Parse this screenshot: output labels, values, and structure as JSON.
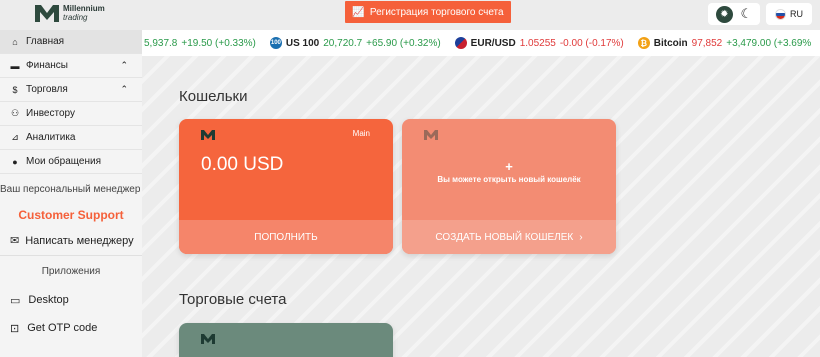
{
  "header": {
    "logo_top": "Millennium",
    "logo_bottom": "trading",
    "register_label": "Регистрация торгового счета",
    "lang": "RU"
  },
  "ticker": [
    {
      "symbol": "",
      "price": "5,937.8",
      "change": "+19.50 (+0.33%)",
      "negative": false,
      "icon": ""
    },
    {
      "symbol": "US 100",
      "price": "20,720.7",
      "change": "+65.90 (+0.32%)",
      "negative": false,
      "icon": "100"
    },
    {
      "symbol": "EUR/USD",
      "price": "1.05255",
      "change": "-0.00 (-0.17%)",
      "negative": true,
      "icon": "eu-us-flag-icon"
    },
    {
      "symbol": "Bitcoin",
      "price": "97,852",
      "change": "+3,479.00 (+3.69%",
      "negative": false,
      "icon": "bitcoin-icon"
    }
  ],
  "sidebar": {
    "items": [
      {
        "label": "Главная",
        "icon": "home-icon"
      },
      {
        "label": "Финансы",
        "icon": "wallet-icon"
      },
      {
        "label": "Торговля",
        "icon": "dollar-icon"
      },
      {
        "label": "Инвестору",
        "icon": "users-icon"
      },
      {
        "label": "Аналитика",
        "icon": "chart-icon"
      },
      {
        "label": "Мои обращения",
        "icon": "chat-icon"
      }
    ],
    "manager_title": "Ваш персональный менеджер",
    "support_label": "Customer Support",
    "write_manager": "Написать менеджеру",
    "apps_title": "Приложения",
    "apps": [
      {
        "label": "Desktop",
        "icon": "desktop-icon"
      },
      {
        "label": "Get OTP code",
        "icon": "robot-icon"
      }
    ]
  },
  "main": {
    "wallets_title": "Кошельки",
    "wallet": {
      "tag": "Main",
      "amount": "0.00 USD",
      "action": "ПОПОЛНИТЬ"
    },
    "new_wallet": {
      "plus": "+",
      "hint": "Вы можете открыть новый кошелёк",
      "action": "СОЗДАТЬ НОВЫЙ КОШЕЛЕК"
    },
    "accounts_title": "Торговые счета"
  },
  "colors": {
    "accent": "#f5603a",
    "brand": "#2e4a3e"
  }
}
